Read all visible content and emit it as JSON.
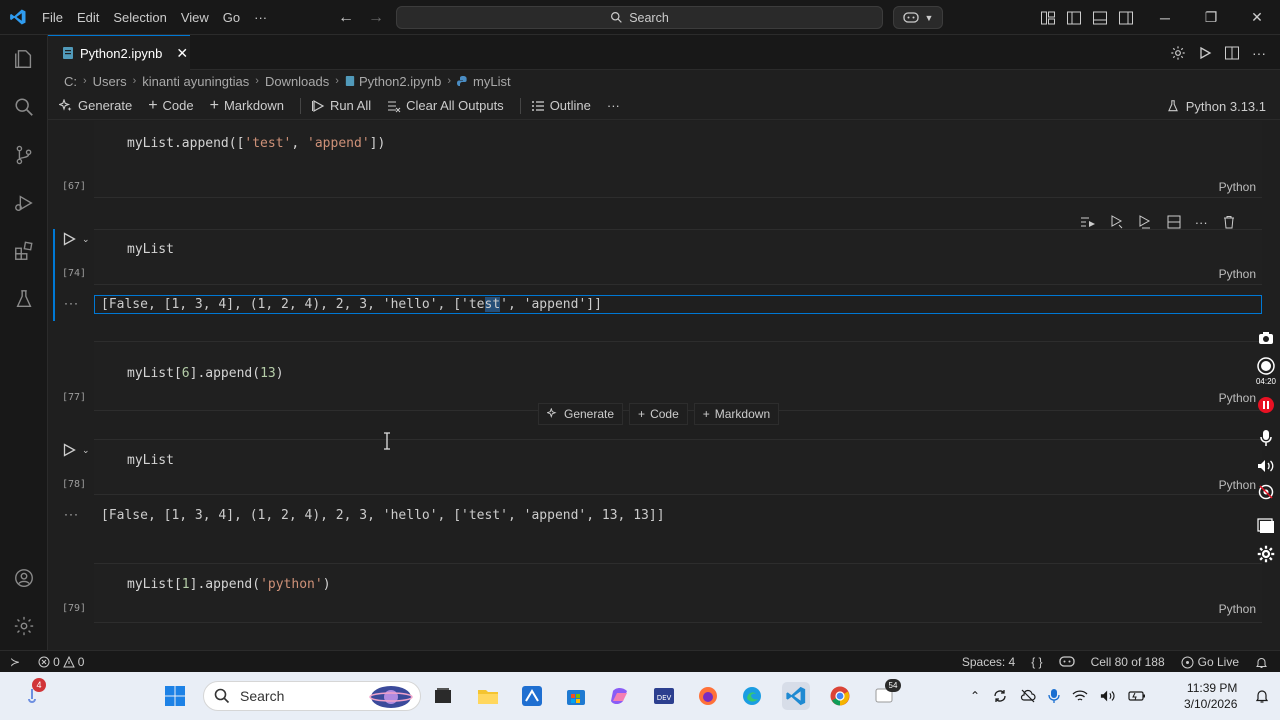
{
  "titlebar": {
    "menu": [
      "File",
      "Edit",
      "Selection",
      "View",
      "Go",
      "···"
    ],
    "search_placeholder": "Search"
  },
  "tab": {
    "filename": "Python2.ipynb"
  },
  "breadcrumbs": [
    "C:",
    "Users",
    "kinanti ayuningtias",
    "Downloads",
    "Python2.ipynb",
    "myList"
  ],
  "toolbar": {
    "generate": "Generate",
    "code": "Code",
    "markdown": "Markdown",
    "run_all": "Run All",
    "clear_all": "Clear All Outputs",
    "outline": "Outline",
    "more": "···",
    "kernel": "Python 3.13.1"
  },
  "cells": [
    {
      "exec": "[67]",
      "lang": "Python"
    },
    {
      "exec": "[74]",
      "lang": "Python",
      "dots": "···"
    },
    {
      "exec": "[77]",
      "lang": "Python"
    },
    {
      "exec": "[78]",
      "lang": "Python",
      "dots": "···"
    },
    {
      "exec": "[79]",
      "lang": "Python"
    }
  ],
  "code": {
    "c67_a": "myList.append([",
    "c67_s1": "'test'",
    "c67_b": ", ",
    "c67_s2": "'append'",
    "c67_c": "])",
    "c74": "myList",
    "c77_a": "myList[",
    "c77_n1": "6",
    "c77_b": "].append(",
    "c77_n2": "13",
    "c77_c": ")",
    "c78": "myList",
    "c79_a": "myList[",
    "c79_n1": "1",
    "c79_b": "].append(",
    "c79_s": "'python'",
    "c79_c": ")"
  },
  "outputs": {
    "o74_a": "[False, [1, 3, 4], (1, 2, 4), 2, 3, 'hello', ['te",
    "o74_sel": "st",
    "o74_b": "', 'append']]",
    "o78": "[False, [1, 3, 4], (1, 2, 4), 2, 3, 'hello', ['test', 'append', 13, 13]]"
  },
  "insert_bar": {
    "generate": "Generate",
    "code": "Code",
    "markdown": "Markdown"
  },
  "recorder": {
    "time": "04:20"
  },
  "statusbar": {
    "errors": "0",
    "warnings": "0",
    "spaces": "Spaces: 4",
    "braces": "{ }",
    "cell": "Cell 80 of 188",
    "golive": "Go Live"
  },
  "taskbar": {
    "search": "Search",
    "badge_app": "4",
    "badge_chat": "54",
    "time": "11:39 PM",
    "date": "3/10/2026"
  },
  "colors": {
    "accent": "#0078d4",
    "string": "#ce9178",
    "number": "#b5cea8"
  }
}
